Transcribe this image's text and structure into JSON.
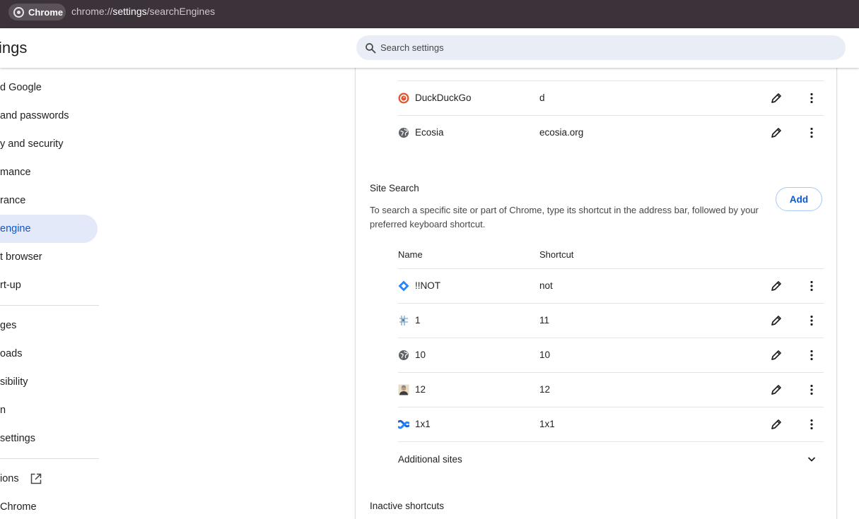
{
  "browser": {
    "chip_label": "Chrome",
    "url_prefix": "chrome://",
    "url_bold": "settings",
    "url_suffix": "/searchEngines"
  },
  "header": {
    "title": "ings",
    "search_placeholder": "Search settings"
  },
  "sidebar": {
    "items": [
      {
        "label": "d Google"
      },
      {
        "label": " and passwords"
      },
      {
        "label": "y and security"
      },
      {
        "label": "mance"
      },
      {
        "label": "rance"
      },
      {
        "label": " engine",
        "active": true
      },
      {
        "label": "t browser"
      },
      {
        "label": "rt-up"
      },
      {
        "label": "ges"
      },
      {
        "label": "oads"
      },
      {
        "label": "sibility"
      },
      {
        "label": "n"
      },
      {
        "label": "settings"
      },
      {
        "label": "ions"
      },
      {
        "label": "Chrome"
      }
    ]
  },
  "search_engines": {
    "rows": [
      {
        "name": "DuckDuckGo",
        "shortcut": "d",
        "icon": "duckduckgo-icon"
      },
      {
        "name": "Ecosia",
        "shortcut": "ecosia.org",
        "icon": "globe-icon"
      }
    ]
  },
  "site_search": {
    "title": "Site Search",
    "add_label": "Add",
    "description": "To search a specific site or part of Chrome, type its shortcut in the address bar, followed by your preferred keyboard shortcut.",
    "col_name": "Name",
    "col_shortcut": "Shortcut",
    "rows": [
      {
        "name": "!!NOT",
        "shortcut": "not",
        "icon": "jira-diamond-icon"
      },
      {
        "name": "1",
        "shortcut": "11",
        "icon": "grid-favicon-icon"
      },
      {
        "name": "10",
        "shortcut": "10",
        "icon": "globe-icon"
      },
      {
        "name": "12",
        "shortcut": "12",
        "icon": "person-favicon-icon"
      },
      {
        "name": "1x1",
        "shortcut": "1x1",
        "icon": "confluence-icon"
      }
    ],
    "additional_sites": "Additional sites"
  },
  "inactive": {
    "title": "Inactive shortcuts"
  },
  "colors": {
    "accent": "#0b57d0",
    "active_bg": "#e3e9f8",
    "topbar": "#3c3239"
  }
}
